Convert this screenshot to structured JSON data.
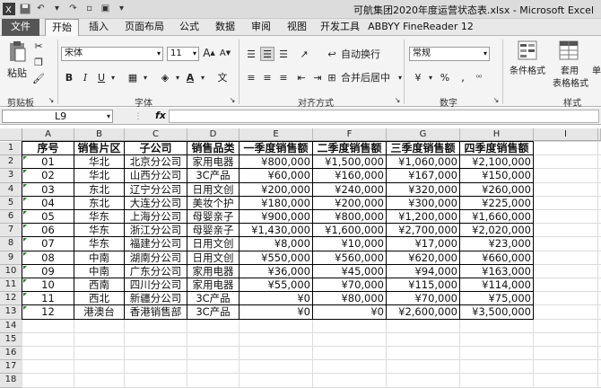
{
  "window": {
    "title": "可航集团2020年度运营状态表.xlsx  -  Microsoft Excel"
  },
  "tabs": [
    "文件",
    "开始",
    "插入",
    "页面布局",
    "公式",
    "数据",
    "审阅",
    "视图",
    "开发工具",
    "ABBYY FineReader 12"
  ],
  "ribbon": {
    "paste": "粘贴",
    "font_name": "宋体",
    "font_size": "11",
    "bold": "B",
    "italic": "I",
    "underline": "U",
    "wrap": "自动换行",
    "merge": "合并后居中",
    "number_format": "常规",
    "cond_format": "条件格式",
    "table_format_1": "套用",
    "table_format_2": "表格格式",
    "cell_styles": "单",
    "groups": [
      "剪贴板",
      "字体",
      "对齐方式",
      "数字",
      "样式"
    ]
  },
  "formula_bar": {
    "name_box": "L9",
    "fx": "fx",
    "content": ""
  },
  "sheet": {
    "columns": [
      "A",
      "B",
      "C",
      "D",
      "E",
      "F",
      "G",
      "H",
      "I"
    ],
    "rows": [
      "1",
      "2",
      "3",
      "4",
      "5",
      "6",
      "7",
      "8",
      "9",
      "10",
      "11",
      "12",
      "13",
      "14",
      "15",
      "16",
      "17",
      "18"
    ],
    "header": [
      "序号",
      "销售片区",
      "子公司",
      "销售品类",
      "一季度销售额",
      "二季度销售额",
      "三季度销售额",
      "四季度销售额"
    ],
    "data": [
      [
        "01",
        "华北",
        "北京分公司",
        "家用电器",
        "¥800,000",
        "¥1,500,000",
        "¥1,060,000",
        "¥2,100,000"
      ],
      [
        "02",
        "华北",
        "山西分公司",
        "3C产品",
        "¥60,000",
        "¥160,000",
        "¥167,000",
        "¥150,000"
      ],
      [
        "03",
        "东北",
        "辽宁分公司",
        "日用文创",
        "¥200,000",
        "¥240,000",
        "¥320,000",
        "¥260,000"
      ],
      [
        "04",
        "东北",
        "大连分公司",
        "美妆个护",
        "¥180,000",
        "¥200,000",
        "¥300,000",
        "¥225,000"
      ],
      [
        "05",
        "华东",
        "上海分公司",
        "母婴亲子",
        "¥900,000",
        "¥800,000",
        "¥1,200,000",
        "¥1,660,000"
      ],
      [
        "06",
        "华东",
        "浙江分公司",
        "母婴亲子",
        "¥1,430,000",
        "¥1,600,000",
        "¥2,700,000",
        "¥2,020,000"
      ],
      [
        "07",
        "华东",
        "福建分公司",
        "日用文创",
        "¥8,000",
        "¥10,000",
        "¥17,000",
        "¥23,000"
      ],
      [
        "08",
        "中南",
        "湖南分公司",
        "日用文创",
        "¥550,000",
        "¥560,000",
        "¥620,000",
        "¥660,000"
      ],
      [
        "09",
        "中南",
        "广东分公司",
        "家用电器",
        "¥36,000",
        "¥45,000",
        "¥94,000",
        "¥163,000"
      ],
      [
        "10",
        "西南",
        "四川分公司",
        "家用电器",
        "¥55,000",
        "¥70,000",
        "¥115,000",
        "¥114,000"
      ],
      [
        "11",
        "西北",
        "新疆分公司",
        "3C产品",
        "¥0",
        "¥80,000",
        "¥70,000",
        "¥75,000"
      ],
      [
        "12",
        "港澳台",
        "香港销售部",
        "3C产品",
        "¥0",
        "¥0",
        "¥2,600,000",
        "¥3,500,000"
      ]
    ]
  }
}
